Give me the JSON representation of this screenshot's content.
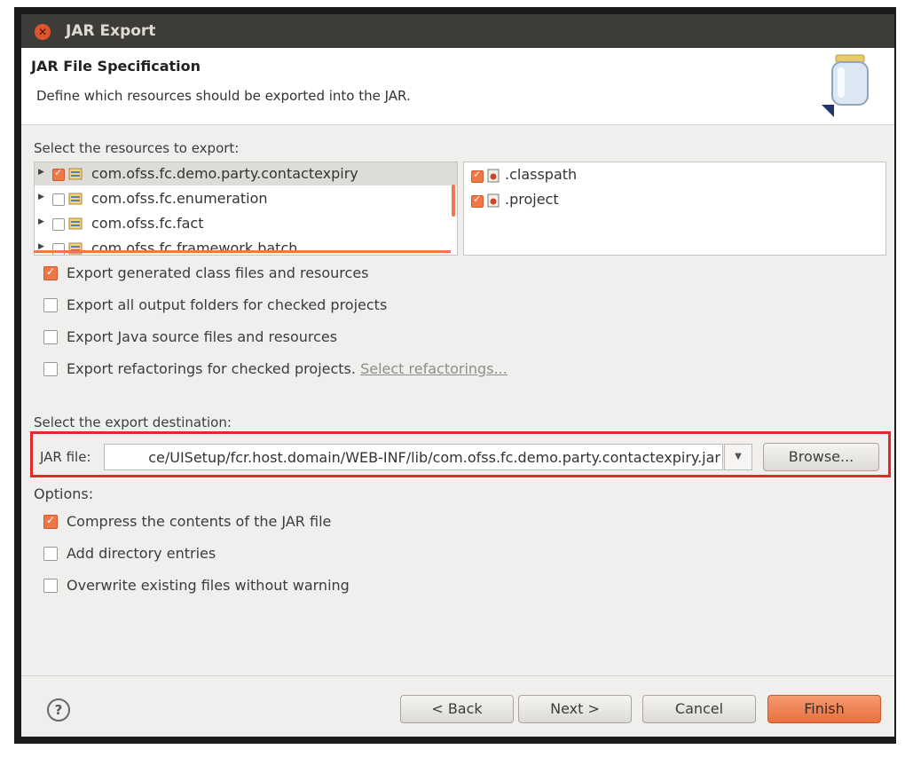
{
  "window": {
    "title": "JAR Export"
  },
  "header": {
    "title": "JAR File Specification",
    "description": "Define which resources should be exported into the JAR."
  },
  "resources": {
    "label": "Select the resources to export:",
    "projects": [
      {
        "name": "com.ofss.fc.demo.party.contactexpiry",
        "checked": true,
        "selected": true
      },
      {
        "name": "com.ofss.fc.enumeration",
        "checked": false
      },
      {
        "name": "com.ofss.fc.fact",
        "checked": false
      },
      {
        "name": "com.ofss.fc.framework.batch",
        "checked": false
      }
    ],
    "files": [
      {
        "name": ".classpath",
        "checked": true
      },
      {
        "name": ".project",
        "checked": true
      }
    ]
  },
  "export_options": [
    {
      "label": "Export generated class files and resources",
      "checked": true
    },
    {
      "label": "Export all output folders for checked projects",
      "checked": false
    },
    {
      "label": "Export Java source files and resources",
      "checked": false
    },
    {
      "label": "Export refactorings for checked projects.",
      "checked": false,
      "link": "Select refactorings..."
    }
  ],
  "destination": {
    "label": "Select the export destination:",
    "jar_label": "JAR file:",
    "jar_value": "ce/UISetup/fcr.host.domain/WEB-INF/lib/com.ofss.fc.demo.party.contactexpiry.jar",
    "browse": "Browse..."
  },
  "options": {
    "label": "Options:",
    "items": [
      {
        "label": "Compress the contents of the JAR file",
        "checked": true
      },
      {
        "label": "Add directory entries",
        "checked": false
      },
      {
        "label": "Overwrite existing files without warning",
        "checked": false
      }
    ]
  },
  "footer": {
    "help": "?",
    "back": "< Back",
    "next": "Next >",
    "cancel": "Cancel",
    "finish": "Finish"
  },
  "colors": {
    "accent": "#f07746",
    "highlight_border": "#e22a2a",
    "titlebar": "#3d3c38"
  },
  "icons": [
    "close-icon",
    "jar-icon",
    "expand-arrow-icon",
    "package-icon",
    "file-icon",
    "dropdown-arrow-icon",
    "help-icon"
  ]
}
